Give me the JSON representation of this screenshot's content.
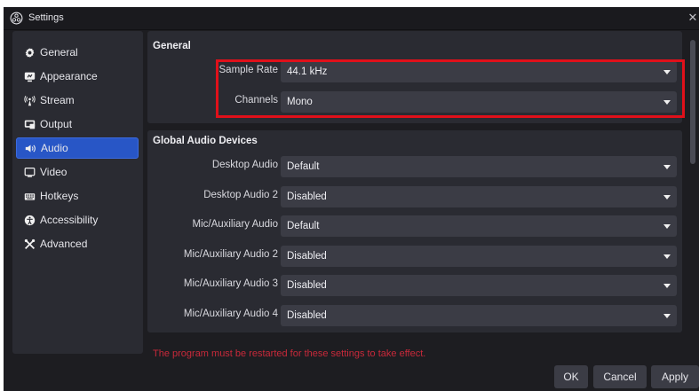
{
  "window": {
    "title": "Settings",
    "close_glyph": "✕"
  },
  "sidebar": {
    "items": [
      {
        "label": "General",
        "icon": "gear-icon",
        "active": false
      },
      {
        "label": "Appearance",
        "icon": "appearance-icon",
        "active": false
      },
      {
        "label": "Stream",
        "icon": "broadcast-icon",
        "active": false
      },
      {
        "label": "Output",
        "icon": "output-icon",
        "active": false
      },
      {
        "label": "Audio",
        "icon": "speaker-icon",
        "active": true
      },
      {
        "label": "Video",
        "icon": "monitor-icon",
        "active": false
      },
      {
        "label": "Hotkeys",
        "icon": "keyboard-icon",
        "active": false
      },
      {
        "label": "Accessibility",
        "icon": "accessibility-icon",
        "active": false
      },
      {
        "label": "Advanced",
        "icon": "tools-icon",
        "active": false
      }
    ]
  },
  "general": {
    "title": "General",
    "sample_rate": {
      "label": "Sample Rate",
      "value": "44.1 kHz"
    },
    "channels": {
      "label": "Channels",
      "value": "Mono"
    }
  },
  "global_audio": {
    "title": "Global Audio Devices",
    "devices": [
      {
        "label": "Desktop Audio",
        "value": "Default"
      },
      {
        "label": "Desktop Audio 2",
        "value": "Disabled"
      },
      {
        "label": "Mic/Auxiliary Audio",
        "value": "Default"
      },
      {
        "label": "Mic/Auxiliary Audio 2",
        "value": "Disabled"
      },
      {
        "label": "Mic/Auxiliary Audio 3",
        "value": "Disabled"
      },
      {
        "label": "Mic/Auxiliary Audio 4",
        "value": "Disabled"
      }
    ]
  },
  "warning": "The program must be restarted for these settings to take effect.",
  "buttons": {
    "ok": "OK",
    "cancel": "Cancel",
    "apply": "Apply"
  },
  "colors": {
    "accent": "#2856c6",
    "highlight_box": "#e0101a",
    "warning_text": "#c8293a",
    "window_bg": "#1d1d21",
    "panel_bg": "#2a2b32",
    "combo_bg": "#3b3c45"
  }
}
